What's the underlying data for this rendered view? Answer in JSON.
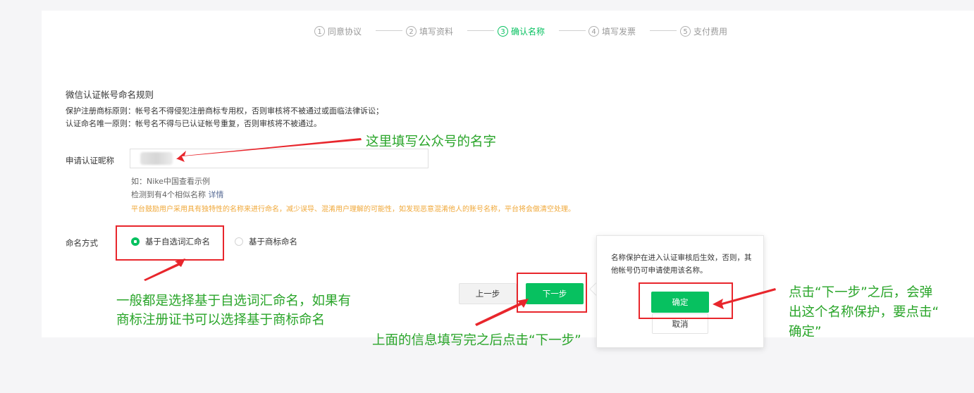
{
  "steps": [
    {
      "num": "1",
      "label": "同意协议",
      "active": false
    },
    {
      "num": "2",
      "label": "填写资料",
      "active": false
    },
    {
      "num": "3",
      "label": "确认名称",
      "active": true
    },
    {
      "num": "4",
      "label": "填写发票",
      "active": false
    },
    {
      "num": "5",
      "label": "支付费用",
      "active": false
    }
  ],
  "rules": {
    "title": "微信认证帐号命名规则",
    "line1": "保护注册商标原则：帐号名不得侵犯注册商标专用权，否则审核将不被通过或面临法律诉讼；",
    "line2": "认证命名唯一原则：帐号名不得与已认证帐号重复，否则审核将不被通过。"
  },
  "nickname": {
    "label": "申请认证昵称",
    "value": "",
    "example": "如：Nike中国查看示例",
    "similar_text": "检测到有4个相似名称",
    "similar_link": "详情",
    "warning": "平台鼓励用户采用具有独特性的名称来进行命名，减少误导、混淆用户理解的可能性，如发现恶意混淆他人的账号名称，平台将会做清空处理。"
  },
  "naming": {
    "label": "命名方式",
    "option1": "基于自选词汇命名",
    "option2": "基于商标命名",
    "selected": "基于自选词汇命名"
  },
  "buttons": {
    "prev": "上一步",
    "next": "下一步"
  },
  "popover": {
    "text": "名称保护在进入认证审核后生效，否则，其他帐号仍可申请使用该名称。",
    "ok": "确定",
    "cancel": "取消"
  },
  "annotations": {
    "fill_name": "这里填写公众号的名字",
    "naming_line1": "一般都是选择基于自选词汇命名，如果有",
    "naming_line2": "商标注册证书可以选择基于商标命名",
    "click_next": "上面的信息填写完之后点击“下一步”",
    "confirm_line1": "点击“下一步”之后，会弹",
    "confirm_line2": "出这个名称保护，要点击“",
    "confirm_line3": "确定”"
  },
  "colors": {
    "accent": "#07c160",
    "annotation_red": "#e8262c",
    "annotation_green": "#2aa52a",
    "warning": "#f0a93b",
    "link": "#576b95"
  }
}
